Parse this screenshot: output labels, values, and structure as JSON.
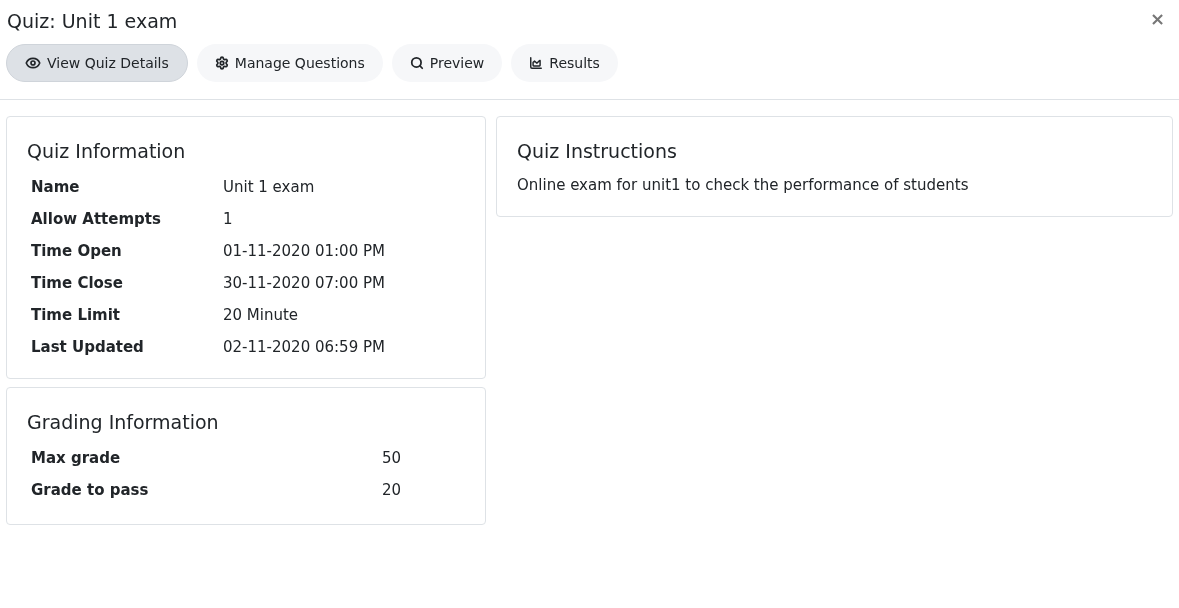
{
  "title": "Quiz: Unit 1 exam",
  "close": "×",
  "tabs": [
    {
      "label": "View Quiz Details",
      "selected": true
    },
    {
      "label": "Manage Questions",
      "selected": false
    },
    {
      "label": "Preview",
      "selected": false
    },
    {
      "label": "Results",
      "selected": false
    }
  ],
  "quiz_information": {
    "heading": "Quiz Information",
    "rows": [
      {
        "label": "Name",
        "value": "Unit 1 exam"
      },
      {
        "label": "Allow Attempts",
        "value": "1"
      },
      {
        "label": "Time Open",
        "value": "01-11-2020 01:00 PM"
      },
      {
        "label": "Time Close",
        "value": "30-11-2020 07:00 PM"
      },
      {
        "label": "Time Limit",
        "value": "20 Minute"
      },
      {
        "label": "Last Updated",
        "value": "02-11-2020 06:59 PM"
      }
    ]
  },
  "grading_information": {
    "heading": "Grading Information",
    "rows": [
      {
        "label": "Max grade",
        "value": "50"
      },
      {
        "label": "Grade to pass",
        "value": "20"
      }
    ]
  },
  "quiz_instructions": {
    "heading": "Quiz Instructions",
    "text": "Online exam for unit1 to check the performance of students"
  }
}
